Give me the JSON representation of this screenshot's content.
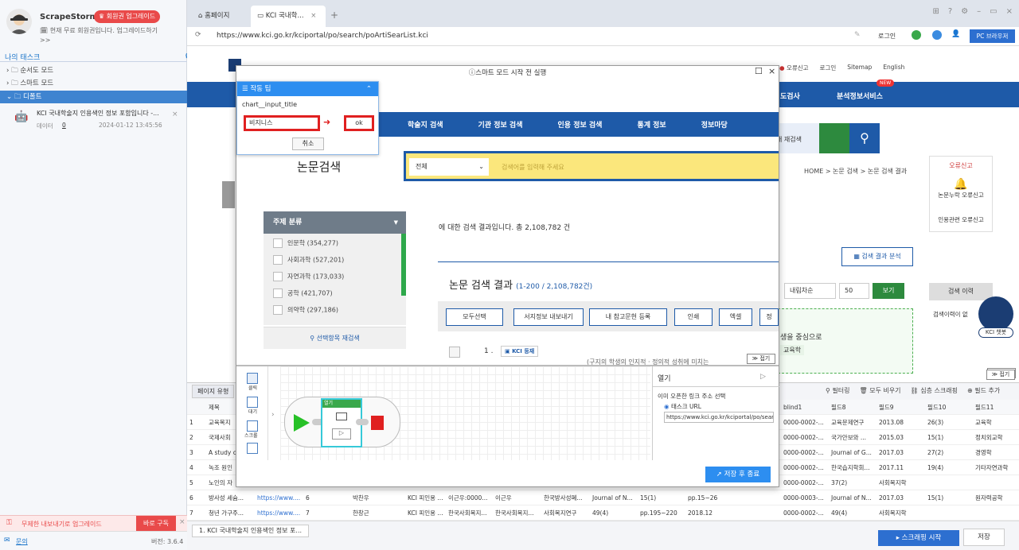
{
  "app": {
    "name": "ScrapeStorm",
    "upgrade_badge": "회원권 업그레이드",
    "free_text": "현재 무료 회원권입니다. 업그레이드하기",
    "more": ">>",
    "my_tasks": "나의 태스크"
  },
  "tree": [
    {
      "label": "순서도 모드"
    },
    {
      "label": "스마트 모드"
    },
    {
      "label": "디폴트"
    }
  ],
  "task": {
    "title": "KCI 국내학술지 인용색인 정보 포함입니다 -...",
    "sub": "데이터",
    "count": "0",
    "date": "2024-01-12 13:45:56"
  },
  "upgrade_promo": {
    "text": "무제한 내보내기로 업그레이드",
    "btn": "바로 구독"
  },
  "footer": {
    "help": "문의",
    "version": "버전: 3.6.4"
  },
  "browser": {
    "tab1": "홈페이지",
    "tab2": "KCI 국내학...",
    "url": "https://www.kci.go.kr/kciportal/po/search/poArtiSearList.kci",
    "login": "로그인",
    "mode": "PC 브라우저"
  },
  "site": {
    "nav": [
      "학술지 검색",
      "기관 정보 검색",
      "인용 정보 검색",
      "통계 정보",
      "정보마당"
    ],
    "nav_right": [
      "도검사",
      "분석정보서비스"
    ],
    "new_badge": "NEW",
    "top_links": [
      "오류신고",
      "로그인",
      "Sitemap",
      "English"
    ],
    "search_title": "논문검색",
    "search_select": "전체",
    "search_placeholder": "검색어를 입력해 주세요",
    "research": "내 재검색",
    "breadcrumb": "HOME > 논문 검색 > 논문 검색 결과",
    "cat_title": "주제 분류",
    "categories": [
      "인문학 (354,277)",
      "사회과학 (527,201)",
      "자연과학 (173,033)",
      "공학 (421,707)",
      "의약학 (297,186)"
    ],
    "cat_search": "선택항목 재검색",
    "result_text": "에 대한 검색 결과입니다. 총 2,108,782 건",
    "result_heading": "논문 검색 결과",
    "result_range": "(1-200 / 2,108,782건)",
    "tools": [
      "모두선택",
      "서지정보 내보내기",
      "내 참고문헌 등록",
      "인쇄",
      "엑셀",
      "정"
    ],
    "item_num": "1 .",
    "kci_badge": "KCI 등재",
    "item_text": "(구지의 학생의 인지적 · 정의적 성취에 미치는",
    "analysis_btn": "검색 결과 분석",
    "sort": "내림차순",
    "size": "50",
    "view": "보기",
    "right_err": "오류신고",
    "right_err1": "논문누락 오류신고",
    "right_err2": "인용관련 오류신고",
    "history": "검색 이력",
    "history_empty": "검색이력이 없",
    "chatbot": "KCI 챗봇",
    "highlight": "생을 중심으로",
    "highlight2": "교육학",
    "fold": "접기",
    "fold2": "접기"
  },
  "modal": {
    "title": "스마트 모드 시작 전 실행",
    "tip_title": "작동 팁",
    "tip_field": "chart__input_title",
    "input_value": "비지니스",
    "ok": "ok",
    "cancel": "취소",
    "tools": [
      "클릭",
      "대기",
      "스크롤",
      ""
    ],
    "flow_label": "열기",
    "panel_title": "열기",
    "panel_q": "이미 오픈한 링크 주소 선택",
    "panel_radio": "태스크 URL",
    "panel_url": "https://www.kci.go.kr/kciportal/po/sear",
    "save": "저장 후 종료"
  },
  "lowbar": {
    "left": "페이지 유형",
    "actions": [
      "필터링",
      "모두 비우기",
      "심층 스크래핑",
      "필드 추가"
    ],
    "fold": "접기"
  },
  "table": {
    "headers": [
      "",
      "제목",
      "",
      "",
      "",
      "",
      "",
      "",
      "",
      "",
      "",
      "",
      "blind1",
      "필드8",
      "필드9",
      "필드10",
      "필드11"
    ],
    "rows": [
      [
        "1",
        "교육복지",
        "",
        "",
        "",
        "",
        "",
        "",
        "",
        "",
        "",
        "",
        "0000-0002-...",
        "교육문제연구",
        "2013.08",
        "26(3)",
        "교육학"
      ],
      [
        "2",
        "국제사회",
        "",
        "",
        "",
        "",
        "",
        "",
        "",
        "",
        "",
        "",
        "0000-0002-...",
        "국가안보와 ...",
        "2015.03",
        "15(1)",
        "정치외교학"
      ],
      [
        "3",
        "A study c",
        "",
        "",
        "",
        "",
        "",
        "",
        "",
        "",
        "",
        "",
        "0000-0002-...",
        "Journal of G...",
        "2017.03",
        "27(2)",
        "경영학"
      ],
      [
        "4",
        "녹조 원인",
        "",
        "",
        "",
        "",
        "",
        "",
        "",
        "",
        "",
        "",
        "0000-0002-...",
        "한국습지학회...",
        "2017.11",
        "19(4)",
        "기타자연과학"
      ],
      [
        "5",
        "노인의 자",
        "",
        "",
        "",
        "",
        "",
        "",
        "",
        "",
        "",
        "",
        "0000-0002-...",
        "37(2)",
        "사회복지학",
        "",
        ""
      ],
      [
        "6",
        "방사성 세슘...",
        "https://www....",
        "6",
        "박찬우",
        "KCI 피인용 ...",
        "이근우:0000...",
        "이근우",
        "한국방사성폐...",
        "Journal of N...",
        "15(1)",
        "pp.15~26",
        "0000-0003-...",
        "Journal of N...",
        "2017.03",
        "15(1)",
        "원자력공학"
      ],
      [
        "7",
        "청년 가구주...",
        "https://www....",
        "7",
        "한창근",
        "KCI 피인용 ...",
        "한국사회복지...",
        "한국사회복지...",
        "사회복지연구",
        "49(4)",
        "pp.195~220",
        "2018.12",
        "0000-0002-...",
        "49(4)",
        "사회복지학",
        "",
        ""
      ]
    ]
  },
  "bottom": {
    "tab": "1. KCI 국내학술지 인용색인 정보 포...",
    "start": "스크래핑 시작",
    "save": "저장"
  }
}
